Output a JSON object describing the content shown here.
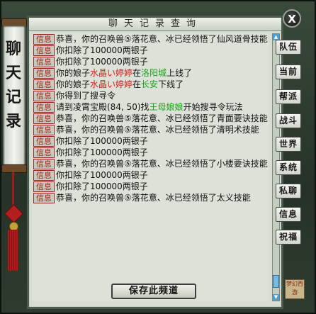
{
  "window": {
    "title": "聊天记录查询",
    "banner_title": "聊天记录",
    "close_label": "X",
    "save_button": "保存此频道",
    "seal_text": "梦幻西游"
  },
  "tabs": [
    {
      "label": "队伍"
    },
    {
      "label": "当前"
    },
    {
      "label": "帮派"
    },
    {
      "label": "战斗"
    },
    {
      "label": "世界"
    },
    {
      "label": "系统"
    },
    {
      "label": "私聊"
    },
    {
      "label": "信息"
    },
    {
      "label": "祝福"
    }
  ],
  "messages": [
    {
      "tag": "信息",
      "parts": [
        {
          "text": "恭喜，你的召唤兽⑤落花意、冰已经领悟了仙风道骨技能"
        }
      ]
    },
    {
      "tag": "信息",
      "parts": [
        {
          "text": "你扣除了100000两银子"
        }
      ]
    },
    {
      "tag": "信息",
      "parts": [
        {
          "text": "你扣除了100000两银子"
        }
      ]
    },
    {
      "tag": "信息",
      "parts": [
        {
          "text": "你的娘子"
        },
        {
          "text": "水晶い婷婷",
          "color": "red"
        },
        {
          "text": "在"
        },
        {
          "text": "洛阳城",
          "color": "green"
        },
        {
          "text": "上线了"
        }
      ]
    },
    {
      "tag": "信息",
      "parts": [
        {
          "text": "你的娘子"
        },
        {
          "text": "水晶い婷婷",
          "color": "red"
        },
        {
          "text": "在"
        },
        {
          "text": "长安",
          "color": "green"
        },
        {
          "text": "下线了"
        }
      ]
    },
    {
      "tag": "信息",
      "parts": [
        {
          "text": "你得到了搜寻令"
        }
      ]
    },
    {
      "tag": "信息",
      "parts": [
        {
          "text": "请到凌霄宝殿(84, 50)找"
        },
        {
          "text": "王母娘娘",
          "color": "green"
        },
        {
          "text": "开始搜寻令玩法"
        }
      ]
    },
    {
      "tag": "信息",
      "parts": [
        {
          "text": "恭喜，你的召唤兽⑤落花意、冰已经领悟了青面要诀技能"
        }
      ]
    },
    {
      "tag": "信息",
      "parts": [
        {
          "text": "恭喜，你的召唤兽⑤落花意、冰已经领悟了清明术技能"
        }
      ]
    },
    {
      "tag": "信息",
      "parts": [
        {
          "text": "你扣除了100000两银子"
        }
      ]
    },
    {
      "tag": "信息",
      "parts": [
        {
          "text": "你扣除了100000两银子"
        }
      ]
    },
    {
      "tag": "信息",
      "parts": [
        {
          "text": "恭喜，你的召唤兽⑤落花意、冰已经领悟了小楼要诀技能"
        }
      ]
    },
    {
      "tag": "信息",
      "parts": [
        {
          "text": "你扣除了100000两银子"
        }
      ]
    },
    {
      "tag": "信息",
      "parts": [
        {
          "text": "你扣除了100000两银子"
        }
      ]
    },
    {
      "tag": "信息",
      "parts": [
        {
          "text": "恭喜，你的召唤兽⑤落花意、冰已经领悟了太义技能"
        }
      ]
    }
  ],
  "colors": {
    "tag_text": "#b21b12",
    "highlight_red": "#d11a1a",
    "highlight_green": "#19a11b"
  }
}
